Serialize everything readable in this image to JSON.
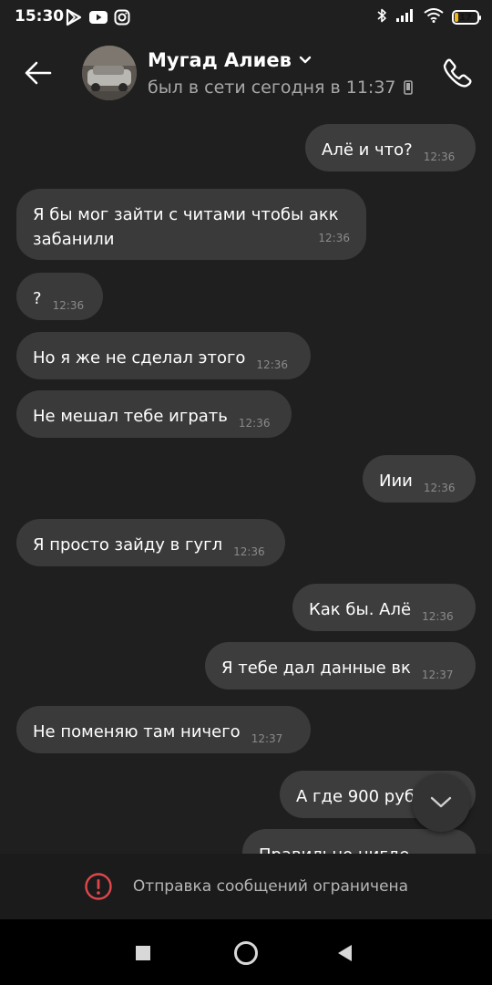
{
  "status_bar": {
    "time": "15:30",
    "battery_level": "17",
    "battery_fraction": 0.17,
    "accent_battery": "#f1b51c",
    "icons": [
      "play-store-icon",
      "youtube-icon",
      "instagram-icon",
      "bluetooth-icon",
      "signal-icon",
      "wifi-icon",
      "battery-icon"
    ]
  },
  "header": {
    "contact_name": "Мугад Алиев",
    "contact_status": "был в сети сегодня в 11:37",
    "icons": [
      "back-arrow-icon",
      "chevron-down-icon",
      "mobile-device-icon",
      "phone-icon"
    ]
  },
  "messages": [
    {
      "direction": "out",
      "text": "Алё и что?",
      "time": "12:36"
    },
    {
      "direction": "in",
      "text": "Я бы мог зайти с читами чтобы акк забанили",
      "time": "12:36"
    },
    {
      "direction": "in",
      "text": "?",
      "time": "12:36"
    },
    {
      "direction": "in",
      "text": "Но я же не сделал этого",
      "time": "12:36"
    },
    {
      "direction": "in",
      "text": "Не мешал тебе играть",
      "time": "12:36"
    },
    {
      "direction": "out",
      "text": "Иии",
      "time": "12:36"
    },
    {
      "direction": "in",
      "text": "Я просто зайду в гугл",
      "time": "12:36"
    },
    {
      "direction": "out",
      "text": "Как бы. Алё",
      "time": "12:36"
    },
    {
      "direction": "out",
      "text": "Я тебе дал данные вк",
      "time": "12:37"
    },
    {
      "direction": "in",
      "text": "Не поменяю там ничего",
      "time": "12:37"
    },
    {
      "direction": "out",
      "text": "А где 900 руб",
      "time": ""
    },
    {
      "direction": "out",
      "text": "Правильно нигде",
      "time": ""
    }
  ],
  "restriction": {
    "text": "Отправка сообщений ограничена",
    "icon": "alert-circle-icon",
    "color": "#e0474c"
  },
  "nav": {
    "icons": [
      "recents-square-icon",
      "home-circle-icon",
      "back-triangle-icon"
    ]
  }
}
